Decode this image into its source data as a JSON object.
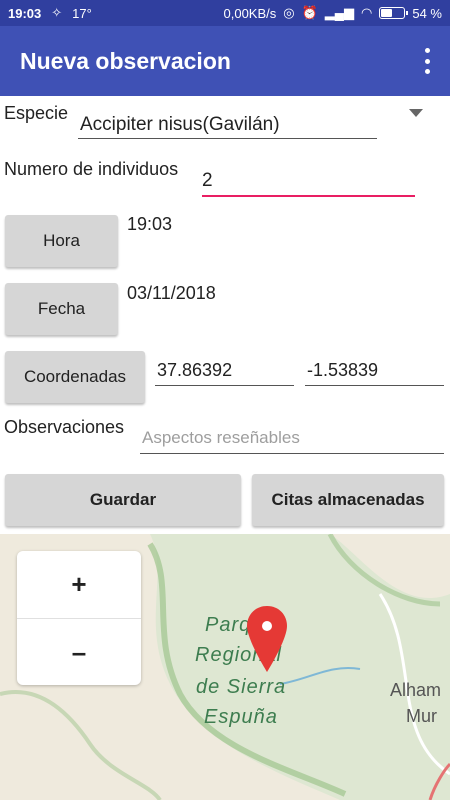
{
  "status_bar": {
    "time": "19:03",
    "temperature": "17°",
    "network_speed": "0,00KB/s",
    "battery_percent": "54 %",
    "battery_level": 0.54
  },
  "app_bar": {
    "title": "Nueva observacion",
    "menu_icon": "overflow-menu-icon"
  },
  "form": {
    "species_label": "Especie",
    "species_value": "Accipiter nisus(Gavilán)",
    "count_label": "Numero de individuos",
    "count_value": "2",
    "time_button": "Hora",
    "time_value": "19:03",
    "date_button": "Fecha",
    "date_value": "03/11/2018",
    "coords_button": "Coordenadas",
    "latitude": "37.86392",
    "longitude": "-1.53839",
    "notes_label": "Observaciones",
    "notes_placeholder": "Aspectos reseñables"
  },
  "actions": {
    "save": "Guardar",
    "stored": "Citas almacenadas"
  },
  "map": {
    "zoom_in": "+",
    "zoom_out": "–",
    "park_label_1": "Parque",
    "park_label_2": "Regional",
    "park_label_3": "de Sierra",
    "park_label_4": "Espuña",
    "town_label_1": "Alham",
    "town_label_2": "Mur",
    "marker_color": "#E53935"
  },
  "colors": {
    "app_bar": "#3F51B5",
    "status_bar": "#303F9F",
    "accent": "#E91E63"
  }
}
